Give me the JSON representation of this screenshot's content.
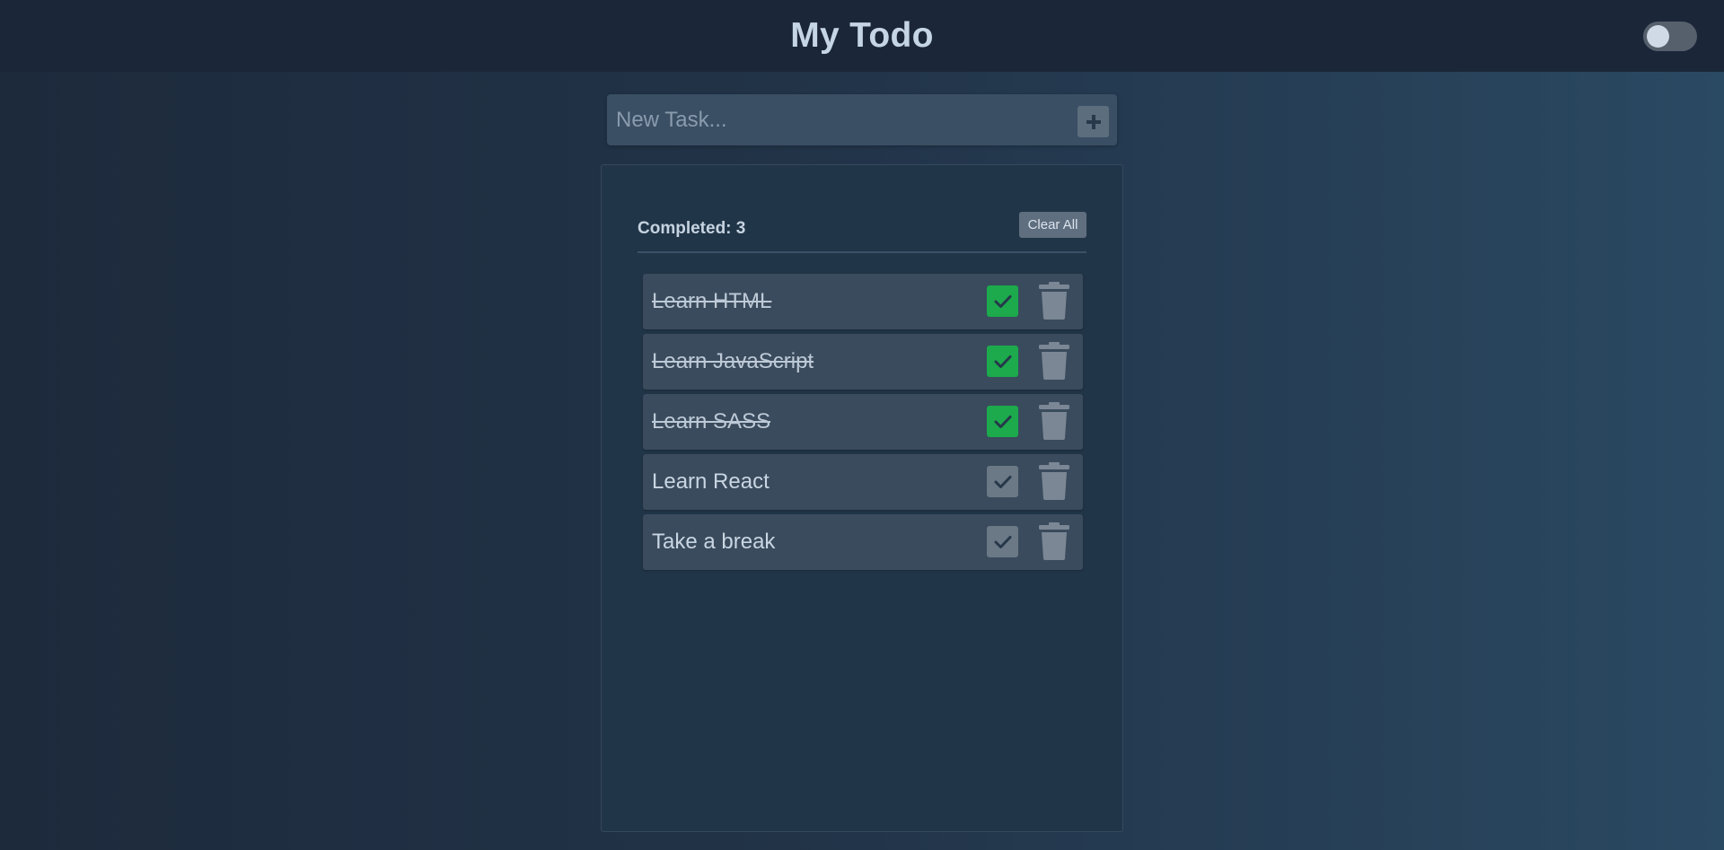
{
  "header": {
    "title": "My Todo",
    "theme_toggle_on": false
  },
  "new_task": {
    "placeholder": "New Task...",
    "value": ""
  },
  "summary": {
    "completed_label": "Completed:",
    "completed_count": "3",
    "clear_all_label": "Clear All"
  },
  "todos": [
    {
      "text": "Learn HTML",
      "done": true
    },
    {
      "text": "Learn JavaScript",
      "done": true
    },
    {
      "text": "Learn SASS",
      "done": true
    },
    {
      "text": "Learn React",
      "done": false
    },
    {
      "text": "Take a break",
      "done": false
    }
  ],
  "icons": {
    "add": "plus-icon",
    "check": "check-icon",
    "delete": "trash-icon"
  },
  "colors": {
    "done_check": "#1caa4c",
    "pending_check": "#6b7886",
    "icon": "#7b8795"
  }
}
